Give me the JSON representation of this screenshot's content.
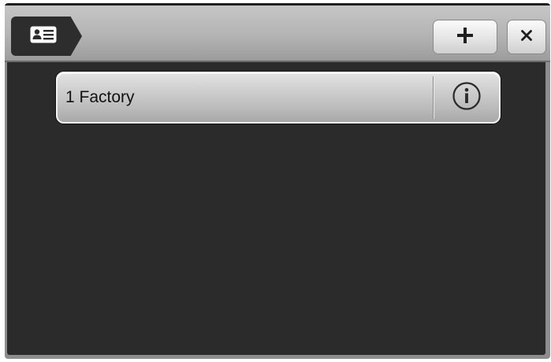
{
  "window": {
    "titlebar": {
      "profile_icon": "contact-card-icon",
      "add_icon": "plus-icon",
      "close_icon": "close-icon"
    },
    "list": {
      "items": [
        {
          "label": "1 Factory",
          "action_icon": "info-icon"
        }
      ]
    }
  },
  "colors": {
    "content_background": "#2b2b2b",
    "titlebar_background": "#b9b9b9",
    "item_background": "#c7c7c7",
    "item_border": "#f2f2f2",
    "icon_dark": "#2d2d2d"
  }
}
